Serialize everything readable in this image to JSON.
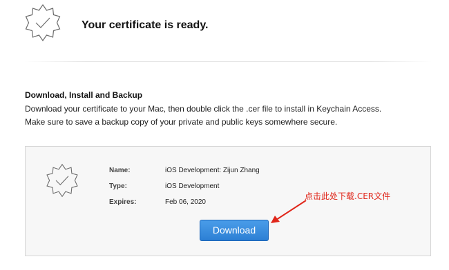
{
  "header": {
    "icon": "certificate-badge-icon",
    "title": "Your certificate is ready."
  },
  "section": {
    "heading": "Download, Install and Backup",
    "line1": "Download your certificate to your Mac, then double click the .cer file to install in Keychain Access.",
    "line2": "Make sure to save a backup copy of your private and public keys somewhere secure."
  },
  "certificate": {
    "icon": "certificate-badge-icon",
    "name_label": "Name:",
    "name_value": "iOS Development: Zijun Zhang",
    "type_label": "Type:",
    "type_value": "iOS Development",
    "expires_label": "Expires:",
    "expires_value": "Feb 06, 2020",
    "download_label": "Download"
  },
  "annotation": {
    "text": "点击此处下载.CER文件",
    "color": "#e0261a"
  },
  "colors": {
    "button": "#2c7fd4",
    "card_background": "#f7f7f7"
  }
}
